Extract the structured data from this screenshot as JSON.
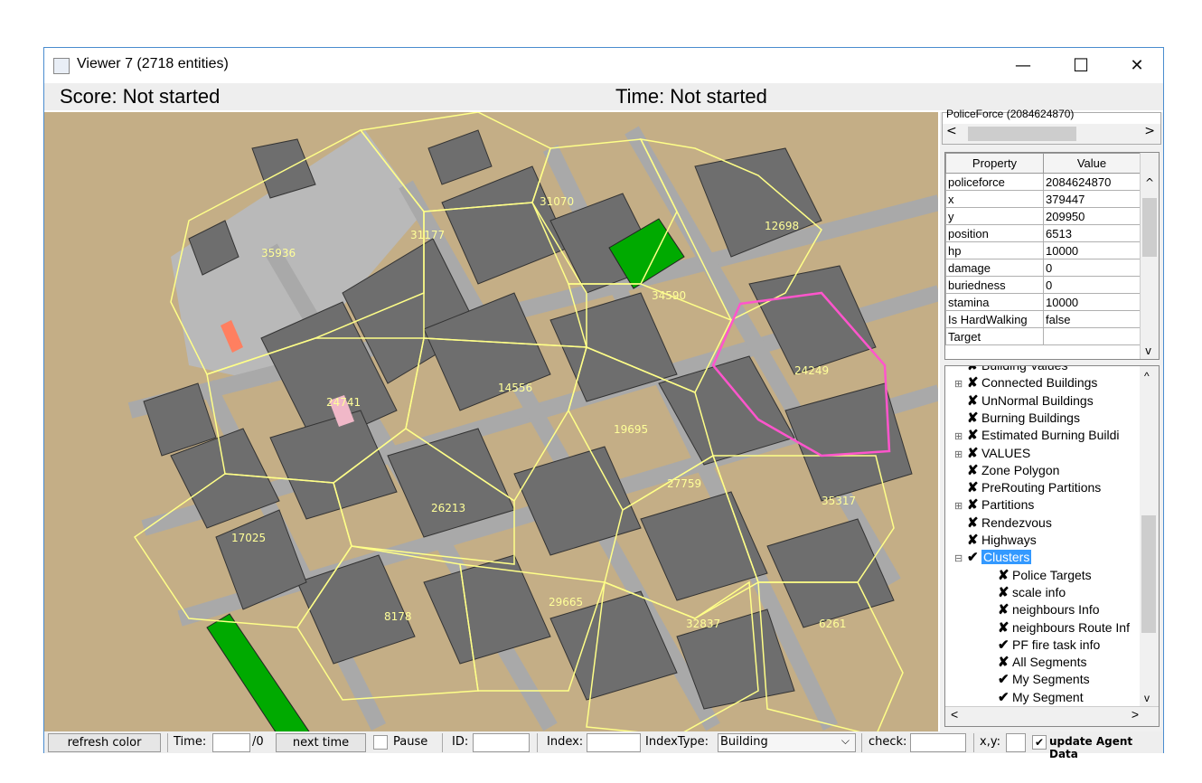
{
  "window": {
    "title": "Viewer 7 (2718 entities)",
    "minimize": "—",
    "maximize": "☐",
    "close": "✕"
  },
  "status": {
    "score": "Score: Not started",
    "time": "Time: Not started"
  },
  "map": {
    "zones": [
      {
        "label": "35936"
      },
      {
        "label": "31177"
      },
      {
        "label": "31070"
      },
      {
        "label": "12698"
      },
      {
        "label": "34590"
      },
      {
        "label": "24249"
      },
      {
        "label": "24741"
      },
      {
        "label": "14556"
      },
      {
        "label": "19695"
      },
      {
        "label": "27759"
      },
      {
        "label": "35317"
      },
      {
        "label": "26213"
      },
      {
        "label": "17025"
      },
      {
        "label": "29665"
      },
      {
        "label": "8178"
      },
      {
        "label": "32837"
      },
      {
        "label": "6261"
      }
    ]
  },
  "props": {
    "partial_label": "PoliceForce (2084624870)",
    "headers": [
      "Property",
      "Value"
    ],
    "rows": [
      [
        "policeforce",
        "2084624870"
      ],
      [
        "x",
        "379447"
      ],
      [
        "y",
        "209950"
      ],
      [
        "position",
        "6513"
      ],
      [
        "hp",
        "10000"
      ],
      [
        "damage",
        "0"
      ],
      [
        "buriedness",
        "0"
      ],
      [
        "stamina",
        "10000"
      ],
      [
        "Is HardWalking",
        "false"
      ],
      [
        "Target",
        ""
      ]
    ]
  },
  "tree": {
    "items": [
      {
        "mark": "✘",
        "label": "Building Values",
        "expander": false,
        "indent": 0
      },
      {
        "mark": "✘",
        "label": "Connected Buildings",
        "expander": true,
        "indent": 0
      },
      {
        "mark": "✘",
        "label": "UnNormal Buildings",
        "expander": false,
        "indent": 0
      },
      {
        "mark": "✘",
        "label": "Burning Buildings",
        "expander": false,
        "indent": 0
      },
      {
        "mark": "✘",
        "label": "Estimated Burning Buildi",
        "expander": true,
        "indent": 0
      },
      {
        "mark": "✘",
        "label": "VALUES",
        "expander": true,
        "indent": 0
      },
      {
        "mark": "✘",
        "label": "Zone Polygon",
        "expander": false,
        "indent": 0
      },
      {
        "mark": "✘",
        "label": "PreRouting Partitions",
        "expander": false,
        "indent": 0
      },
      {
        "mark": "✘",
        "label": "Partitions",
        "expander": true,
        "indent": 0
      },
      {
        "mark": "✘",
        "label": "Rendezvous",
        "expander": false,
        "indent": 0
      },
      {
        "mark": "✘",
        "label": "Highways",
        "expander": false,
        "indent": 0
      },
      {
        "mark": "✔",
        "label": "Clusters",
        "expander": true,
        "indent": 0,
        "selected": true
      },
      {
        "mark": "✘",
        "label": "Police Targets",
        "indent": 1
      },
      {
        "mark": "✘",
        "label": "scale info",
        "indent": 1
      },
      {
        "mark": "✘",
        "label": "neighbours Info",
        "indent": 1
      },
      {
        "mark": "✘",
        "label": "neighbours Route Inf",
        "indent": 1
      },
      {
        "mark": "✔",
        "label": "PF fire task info",
        "indent": 1
      },
      {
        "mark": "✘",
        "label": "All Segments",
        "indent": 1
      },
      {
        "mark": "✔",
        "label": "My Segments",
        "indent": 1
      },
      {
        "mark": "✔",
        "label": "My Segment",
        "indent": 1
      }
    ]
  },
  "bottom": {
    "refresh": "refresh color",
    "time_label": "Time:",
    "time_suffix": "/0",
    "next_time": "next time",
    "pause": "Pause",
    "id_label": "ID:",
    "index_label": "Index:",
    "indextype_label": "IndexType:",
    "indextype_value": "Building",
    "check_label": "check:",
    "xy_label": "x,y:",
    "update": "update Agent Data"
  }
}
